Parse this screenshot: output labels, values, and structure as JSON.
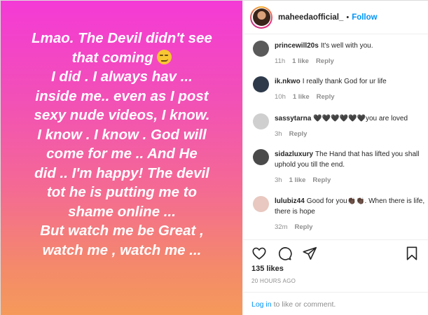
{
  "post": {
    "story_lines": [
      "Lmao.  The Devil didn't see",
      "that coming",
      "I did . I always hav ...",
      "inside me.. even as I post",
      "sexy nude videos,  I know.",
      "I know . I know . God will",
      "come for me .. And He",
      "did ..  I'm happy! The devil",
      "tot he is putting me to",
      "shame online ...",
      "But watch me be Great ,",
      "watch me , watch me ..."
    ],
    "emoji_icon": "smirking-face"
  },
  "header": {
    "username": "maheedaofficial_",
    "separator": "•",
    "follow_label": "Follow"
  },
  "comments": [
    {
      "user": "princewill20s",
      "text": "It's well with you.",
      "time": "11h",
      "likes": "1 like",
      "reply": "Reply",
      "avatar_color": "#5a5a5a"
    },
    {
      "user": "ik.nkwo",
      "text": "I really thank God for ur life",
      "time": "10h",
      "likes": "1 like",
      "reply": "Reply",
      "avatar_color": "#2e3a4a"
    },
    {
      "user": "sassytarna",
      "text": "🖤🖤🖤🖤🖤🖤you are loved",
      "time": "3h",
      "likes": "",
      "reply": "Reply",
      "avatar_color": "#cfcfcf"
    },
    {
      "user": "sidazluxury",
      "text": "The Hand that has lifted you shall uphold you till the end.",
      "time": "3h",
      "likes": "1 like",
      "reply": "Reply",
      "avatar_color": "#4a4a4a"
    },
    {
      "user": "lulubiz44",
      "text": "Good for you👏🏿👏🏿. When there is life, there is hope",
      "time": "32m",
      "likes": "",
      "reply": "Reply",
      "avatar_color": "#e8c8c0"
    }
  ],
  "actions": {
    "likes_label": "135 likes",
    "timestamp": "20 HOURS AGO",
    "login_link": "Log in",
    "login_text": "to like or comment."
  }
}
